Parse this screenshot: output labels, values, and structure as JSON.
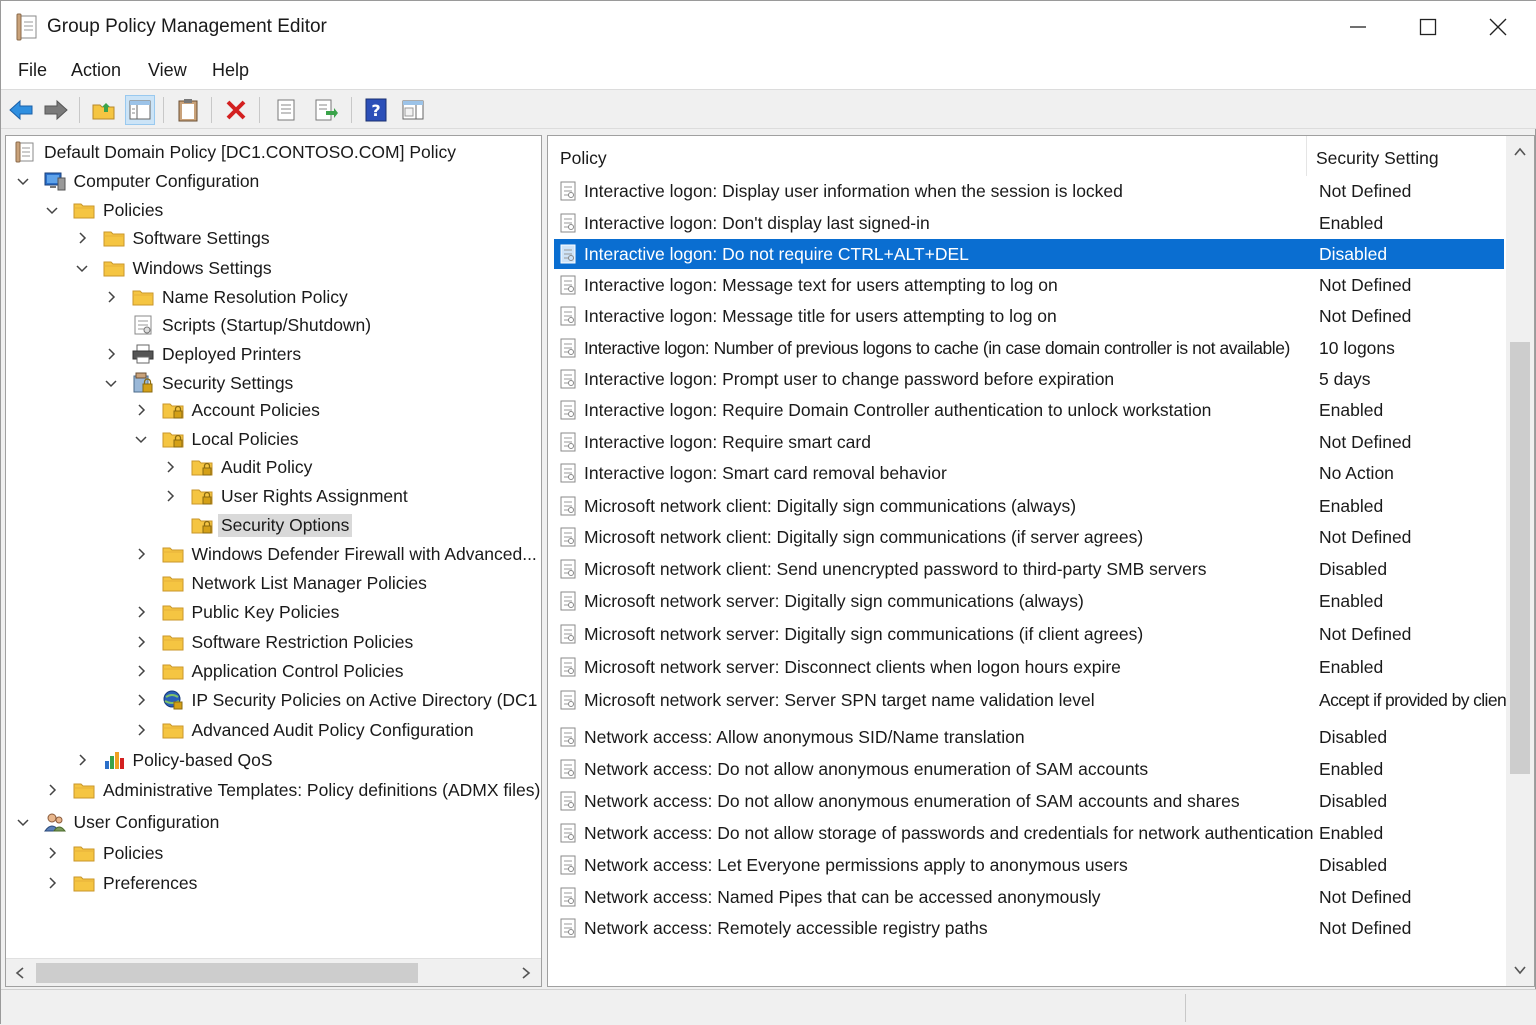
{
  "window": {
    "title": "Group Policy Management Editor"
  },
  "menu": [
    "File",
    "Action",
    "View",
    "Help"
  ],
  "tree": [
    {
      "label": "Default Domain Policy [DC1.CONTOSO.COM] Policy",
      "indent": 0,
      "expander": "none",
      "icon": "policy-doc-icon"
    },
    {
      "label": "Computer Configuration",
      "indent": 1,
      "expander": "expanded",
      "icon": "computer-icon"
    },
    {
      "label": "Policies",
      "indent": 2,
      "expander": "expanded",
      "icon": "folder-icon"
    },
    {
      "label": "Software Settings",
      "indent": 3,
      "expander": "collapsed",
      "icon": "folder-icon"
    },
    {
      "label": "Windows Settings",
      "indent": 3,
      "expander": "expanded",
      "icon": "folder-icon"
    },
    {
      "label": "Name Resolution Policy",
      "indent": 4,
      "expander": "collapsed",
      "icon": "folder-icon"
    },
    {
      "label": "Scripts (Startup/Shutdown)",
      "indent": 4,
      "expander": "none",
      "icon": "script-icon"
    },
    {
      "label": "Deployed Printers",
      "indent": 4,
      "expander": "collapsed",
      "icon": "printer-icon"
    },
    {
      "label": "Security Settings",
      "indent": 4,
      "expander": "expanded",
      "icon": "security-settings-icon"
    },
    {
      "label": "Account Policies",
      "indent": 5,
      "expander": "collapsed",
      "icon": "locked-folder-icon"
    },
    {
      "label": "Local Policies",
      "indent": 5,
      "expander": "expanded",
      "icon": "locked-folder-icon"
    },
    {
      "label": "Audit Policy",
      "indent": 6,
      "expander": "collapsed",
      "icon": "locked-folder-icon"
    },
    {
      "label": "User Rights Assignment",
      "indent": 6,
      "expander": "collapsed",
      "icon": "locked-folder-icon"
    },
    {
      "label": "Security Options",
      "indent": 6,
      "expander": "none",
      "icon": "locked-folder-icon",
      "selected": true
    },
    {
      "label": "Windows Defender Firewall with Advanced...",
      "indent": 5,
      "expander": "collapsed",
      "icon": "folder-icon"
    },
    {
      "label": "Network List Manager Policies",
      "indent": 5,
      "expander": "none",
      "icon": "folder-icon"
    },
    {
      "label": "Public Key Policies",
      "indent": 5,
      "expander": "collapsed",
      "icon": "folder-icon"
    },
    {
      "label": "Software Restriction Policies",
      "indent": 5,
      "expander": "collapsed",
      "icon": "folder-icon"
    },
    {
      "label": "Application Control Policies",
      "indent": 5,
      "expander": "collapsed",
      "icon": "folder-icon"
    },
    {
      "label": "IP Security Policies on Active Directory (DC1",
      "indent": 5,
      "expander": "collapsed",
      "icon": "ipsec-icon"
    },
    {
      "label": "Advanced Audit Policy Configuration",
      "indent": 5,
      "expander": "collapsed",
      "icon": "folder-icon"
    },
    {
      "label": "Policy-based QoS",
      "indent": 3,
      "expander": "collapsed",
      "icon": "qos-chart-icon"
    },
    {
      "label": "Administrative Templates: Policy definitions (ADMX files)",
      "indent": 2,
      "expander": "collapsed",
      "icon": "folder-icon"
    },
    {
      "label": "User Configuration",
      "indent": 1,
      "expander": "expanded",
      "icon": "users-icon"
    },
    {
      "label": "Policies",
      "indent": 2,
      "expander": "collapsed",
      "icon": "folder-icon"
    },
    {
      "label": "Preferences",
      "indent": 2,
      "expander": "collapsed",
      "icon": "folder-icon"
    }
  ],
  "list": {
    "columns": {
      "policy": "Policy",
      "setting": "Security Setting"
    },
    "rows": [
      {
        "policy": "Interactive logon: Display user information when the session is locked",
        "setting": "Not Defined"
      },
      {
        "policy": "Interactive logon: Don't display last signed-in",
        "setting": "Enabled"
      },
      {
        "policy": "Interactive logon: Do not require CTRL+ALT+DEL",
        "setting": "Disabled",
        "selected": true
      },
      {
        "policy": "Interactive logon: Message text for users attempting to log on",
        "setting": "Not Defined"
      },
      {
        "policy": "Interactive logon: Message title for users attempting to log on",
        "setting": "Not Defined"
      },
      {
        "policy": "Interactive logon: Number of previous logons to cache (in case domain controller is not available)",
        "setting": "10 logons"
      },
      {
        "policy": "Interactive logon: Prompt user to change password before expiration",
        "setting": "5 days"
      },
      {
        "policy": "Interactive logon: Require Domain Controller authentication to unlock workstation",
        "setting": "Enabled"
      },
      {
        "policy": "Interactive logon: Require smart card",
        "setting": "Not Defined"
      },
      {
        "policy": "Interactive logon: Smart card removal behavior",
        "setting": "No Action"
      },
      {
        "policy": "Microsoft network client: Digitally sign communications (always)",
        "setting": "Enabled"
      },
      {
        "policy": "Microsoft network client: Digitally sign communications (if server agrees)",
        "setting": "Not Defined"
      },
      {
        "policy": "Microsoft network client: Send unencrypted password to third-party SMB servers",
        "setting": "Disabled"
      },
      {
        "policy": "Microsoft network server: Digitally sign communications (always)",
        "setting": "Enabled"
      },
      {
        "policy": "Microsoft network server: Digitally sign communications (if client agrees)",
        "setting": "Not Defined"
      },
      {
        "policy": "Microsoft network server: Disconnect clients when logon hours expire",
        "setting": "Enabled"
      },
      {
        "policy": "Microsoft network server: Server SPN target name validation level",
        "setting": "Accept if provided by client"
      },
      {
        "policy": "Network access: Allow anonymous SID/Name translation",
        "setting": "Disabled"
      },
      {
        "policy": "Network access: Do not allow anonymous enumeration of SAM accounts",
        "setting": "Enabled"
      },
      {
        "policy": "Network access: Do not allow anonymous enumeration of SAM accounts and shares",
        "setting": "Disabled"
      },
      {
        "policy": "Network access: Do not allow storage of passwords and credentials for network authentication",
        "setting": "Enabled"
      },
      {
        "policy": "Network access: Let Everyone permissions apply to anonymous users",
        "setting": "Disabled"
      },
      {
        "policy": "Network access: Named Pipes that can be accessed anonymously",
        "setting": "Not Defined"
      },
      {
        "policy": "Network access: Remotely accessible registry paths",
        "setting": "Not Defined"
      }
    ]
  },
  "colors": {
    "selection": "#0a6ed1",
    "tree_selection": "#d9d9d9",
    "folder": "#f5c542"
  }
}
